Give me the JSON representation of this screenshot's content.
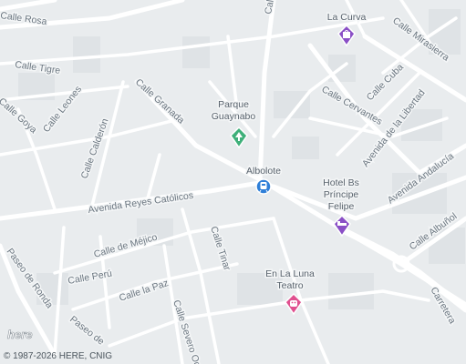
{
  "colors": {
    "background": "#e9ecee",
    "road": "#ffffff",
    "block": "#dfe3e6",
    "park_pin": "#3fb07a",
    "shopping_pin": "#8a4fc6",
    "transit_pin": "#2f7fd8",
    "theatre_pin": "#e0508f",
    "label": "#6b7680"
  },
  "streets": [
    {
      "id": "calle-rosa",
      "name": "Calle Rosa"
    },
    {
      "id": "calle-tigre",
      "name": "Calle Tigre"
    },
    {
      "id": "calle-leones",
      "name": "Calle Leones"
    },
    {
      "id": "calle-goya",
      "name": "Calle Goya"
    },
    {
      "id": "calle-granada",
      "name": "Calle Granada"
    },
    {
      "id": "calle-calderon",
      "name": "Calle Calderón"
    },
    {
      "id": "avenida-reyes-catolicos",
      "name": "Avenida Reyes Católicos"
    },
    {
      "id": "calle-de-mejico",
      "name": "Calle de Méjico"
    },
    {
      "id": "calle-tinar",
      "name": "Calle Tinar"
    },
    {
      "id": "calle-peru",
      "name": "Calle Perú"
    },
    {
      "id": "calle-la-paz",
      "name": "Calle la Paz"
    },
    {
      "id": "calle-severo-oc",
      "name": "Calle Severo Oc"
    },
    {
      "id": "paseo-de-ronda",
      "name": "Paseo de Ronda"
    },
    {
      "id": "paseo-de",
      "name": "Paseo de"
    },
    {
      "id": "calle-cervantes",
      "name": "Calle Cervantes"
    },
    {
      "id": "calle-cuba",
      "name": "Calle Cuba"
    },
    {
      "id": "calle-mirasierra",
      "name": "Calle Mirasierra"
    },
    {
      "id": "avenida-de-la-libertad",
      "name": "Avenida de la Libertad"
    },
    {
      "id": "avenida-andalucia",
      "name": "Avenida Andalucía"
    },
    {
      "id": "calle-albunol",
      "name": "Calle Albuñol"
    },
    {
      "id": "carretera",
      "name": "Carretera"
    },
    {
      "id": "calle-top",
      "name": "Calle"
    }
  ],
  "pois": [
    {
      "id": "parque",
      "lines": [
        "Parque",
        "Guaynabo"
      ],
      "icon": "park-icon",
      "kind": "park"
    },
    {
      "id": "la-curva",
      "lines": [
        "La Curva"
      ],
      "icon": "shopping-bag-icon",
      "kind": "shopping"
    },
    {
      "id": "albolote",
      "lines": [
        "Albolote"
      ],
      "icon": "train-icon",
      "kind": "transit"
    },
    {
      "id": "hotel",
      "lines": [
        "Hotel Bs",
        "Príncipe",
        "Felipe"
      ],
      "icon": "bed-icon",
      "kind": "shopping"
    },
    {
      "id": "teatro",
      "lines": [
        "En La Luna",
        "Teatro"
      ],
      "icon": "theatre-mask-icon",
      "kind": "theatre"
    }
  ],
  "branding": {
    "logo": "here",
    "copyright": "© 1987-2026 HERE, CNIG"
  }
}
